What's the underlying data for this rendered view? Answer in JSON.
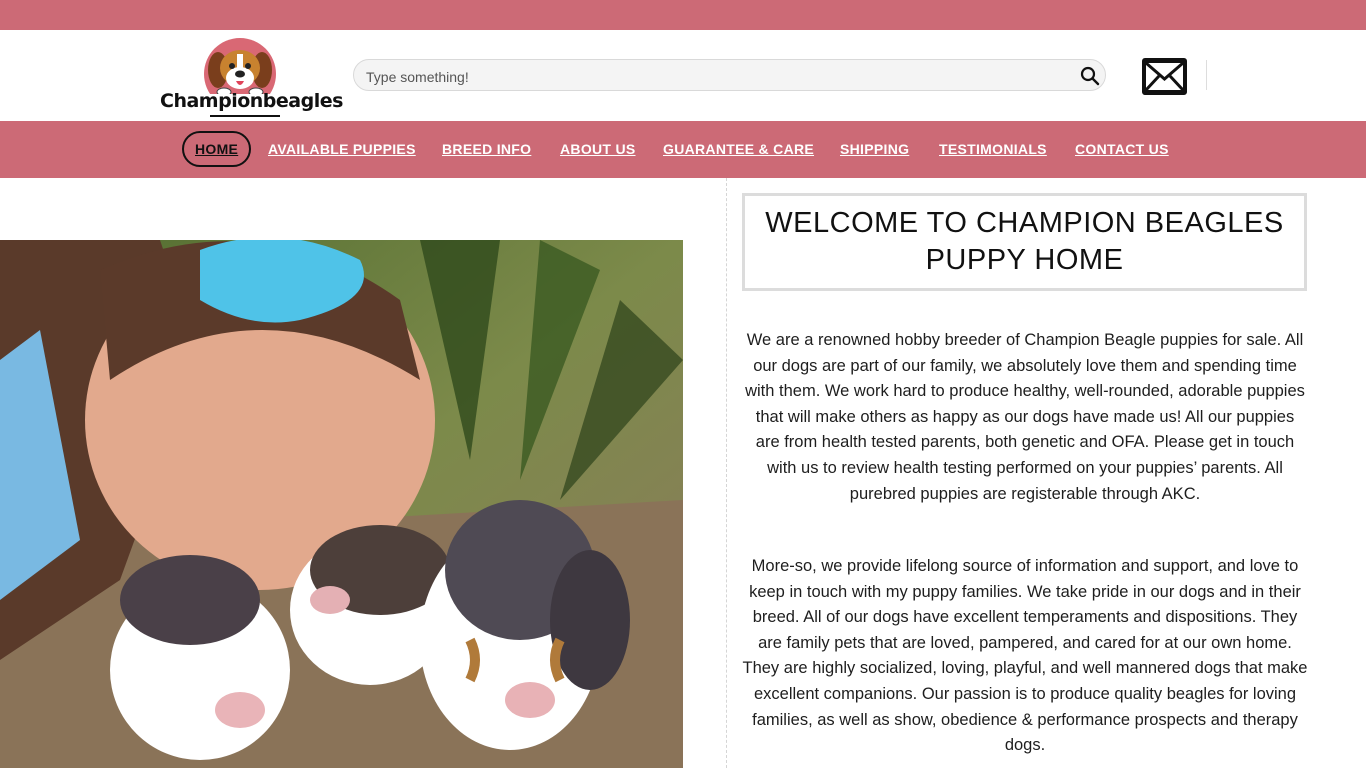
{
  "header": {
    "logo_text": "Championbeagles",
    "search_placeholder": "Type something!",
    "search_icon": "search-icon",
    "mail_icon": "envelope-icon"
  },
  "nav": {
    "items": [
      {
        "label": "HOME",
        "active": true
      },
      {
        "label": "AVAILABLE PUPPIES"
      },
      {
        "label": "BREED INFO"
      },
      {
        "label": "ABOUT US"
      },
      {
        "label": "GUARANTEE & CARE"
      },
      {
        "label": "SHIPPING"
      },
      {
        "label": "TESTIMONIALS"
      },
      {
        "label": "CONTACT US"
      }
    ]
  },
  "main": {
    "welcome_title": "WELCOME TO CHAMPION BEAGLES PUPPY HOME",
    "paragraphs": [
      "We are a renowned hobby breeder of Champion Beagle puppies for sale. All our dogs are part of our family, we absolutely love them and spending time with them. We work hard to produce healthy, well-rounded, adorable puppies that will make others as happy as our dogs have made us! All our puppies are from health tested parents, both genetic and OFA. Please get in touch with us to review health testing performed on your puppies’ parents. All purebred puppies are registerable through AKC.",
      "More-so, we provide lifelong source of information and support, and love to keep in touch with my puppy families. We take pride in our dogs and in their breed. All of our dogs have excellent temperaments and dispositions. They are family pets that are loved, pampered, and cared for at our own home. They are highly socialized, loving, playful, and well mannered dogs that make excellent companions. Our passion is to produce quality beagles for loving families, as well as show, obedience & performance prospects and therapy dogs."
    ]
  },
  "colors": {
    "brand_pink": "#cc6a76",
    "text": "#1a1a1a"
  }
}
